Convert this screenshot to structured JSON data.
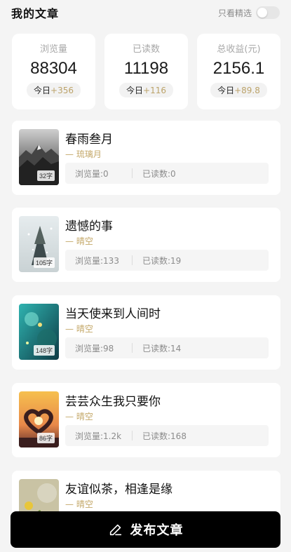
{
  "header": {
    "title": "我的文章",
    "filter_label": "只看精选",
    "filter_on": false
  },
  "stats": [
    {
      "label": "浏览量",
      "value": "88304",
      "today_label": "今日",
      "today_delta": "+356"
    },
    {
      "label": "已读数",
      "value": "11198",
      "today_label": "今日",
      "today_delta": "+116"
    },
    {
      "label": "总收益(元)",
      "value": "2156.1",
      "today_label": "今日",
      "today_delta": "+89.8"
    }
  ],
  "articles": [
    {
      "title": "春雨叁月",
      "author": "— 琉璃月",
      "word_count": "32字",
      "views": "浏览量:0",
      "reads": "已读数:0"
    },
    {
      "title": "遗憾的事",
      "author": "— 晴空",
      "word_count": "105字",
      "views": "浏览量:133",
      "reads": "已读数:19"
    },
    {
      "title": "当天使来到人间时",
      "author": "— 晴空",
      "word_count": "148字",
      "views": "浏览量:98",
      "reads": "已读数:14"
    },
    {
      "title": "芸芸众生我只要你",
      "author": "— 晴空",
      "word_count": "86字",
      "views": "浏览量:1.2k",
      "reads": "已读数:168"
    },
    {
      "title": "友谊似茶，相逢是缘",
      "author": "— 晴空"
    }
  ],
  "publish": {
    "label": "发布文章",
    "icon": "pencil-icon"
  },
  "colors": {
    "accent_gold": "#c4a869",
    "background": "#f4f4f4",
    "button": "#000000"
  }
}
